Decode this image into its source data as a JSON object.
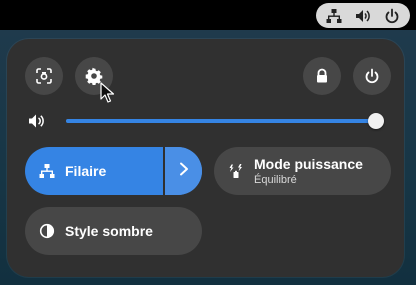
{
  "colors": {
    "accent": "#3584e4",
    "panel": "#303030",
    "button": "#474747",
    "tray": "#d9d9d9"
  },
  "tray": {
    "icons": [
      "network-wired-icon",
      "speaker-volume-icon",
      "power-icon"
    ]
  },
  "panel": {
    "top_buttons": [
      {
        "name": "screenshot-button",
        "icon": "screenshot-icon"
      },
      {
        "name": "settings-button",
        "icon": "gear-icon"
      },
      {
        "name": "lock-button",
        "icon": "lock-icon"
      },
      {
        "name": "power-menu-button",
        "icon": "power-icon"
      }
    ],
    "volume": {
      "icon": "speaker-volume-icon",
      "level": 1.0
    },
    "toggles": {
      "wired": {
        "label": "Filaire",
        "active": true,
        "icon": "network-wired-icon"
      },
      "power_mode": {
        "label": "Mode puissance",
        "sublabel": "Équilibré",
        "icon": "power-profile-icon"
      },
      "dark_style": {
        "label": "Style sombre",
        "active": false,
        "icon": "dark-style-icon"
      }
    }
  }
}
